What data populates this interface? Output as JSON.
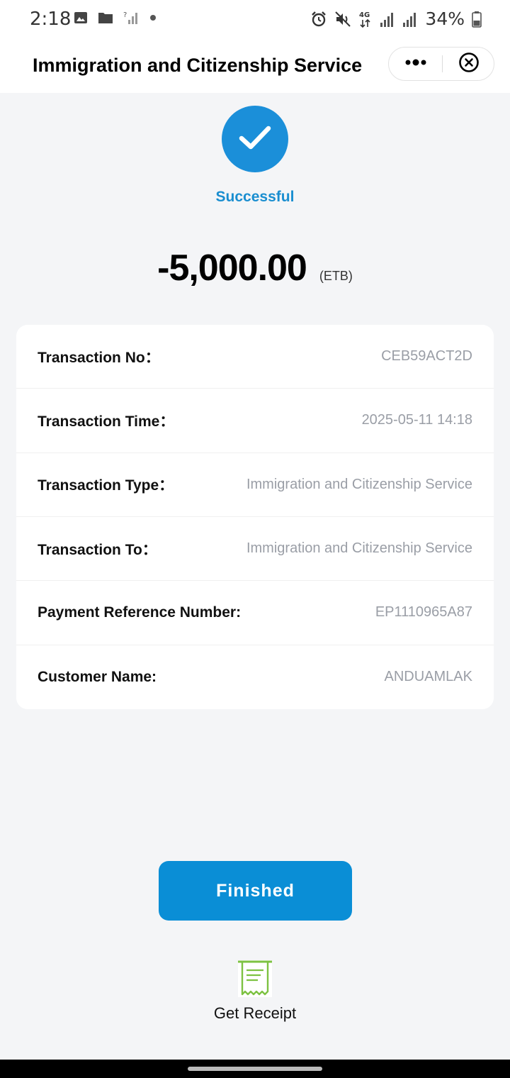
{
  "status_bar": {
    "time": "2:18",
    "battery": "34%",
    "network_label": "4G",
    "left_icons": [
      "image-icon",
      "folder-icon",
      "signal-question-icon",
      "dot-icon"
    ],
    "right_icons": [
      "alarm-icon",
      "mute-icon",
      "network-4g-icon",
      "signal-icon",
      "signal-icon",
      "battery-icon"
    ]
  },
  "header": {
    "title": "Immigration and Citizenship Service",
    "more_icon": "more-dots-icon",
    "close_icon": "close-circle-icon"
  },
  "result": {
    "status": "Successful",
    "icon": "check-icon",
    "amount": "-5,000.00",
    "currency": "(ETB)"
  },
  "details": [
    {
      "label": "Transaction No：",
      "value": "CEB59ACT2D"
    },
    {
      "label": "Transaction Time：",
      "value": "2025-05-11 14:18"
    },
    {
      "label": "Transaction Type：",
      "value": "Immigration and Citizenship Service"
    },
    {
      "label": "Transaction To：",
      "value": "Immigration and Citizenship Service"
    },
    {
      "label": "Payment Reference Number:",
      "value": "EP1110965A87"
    },
    {
      "label": "Customer Name:",
      "value": "ANDUAMLAK"
    }
  ],
  "actions": {
    "finished_label": "Finished",
    "receipt_label": "Get Receipt",
    "receipt_icon": "receipt-icon"
  },
  "colors": {
    "accent": "#0a8ed6",
    "success": "#1b8fd9",
    "receipt_green": "#7dc242",
    "value_gray": "#9a9ea6",
    "background": "#f4f5f7"
  }
}
